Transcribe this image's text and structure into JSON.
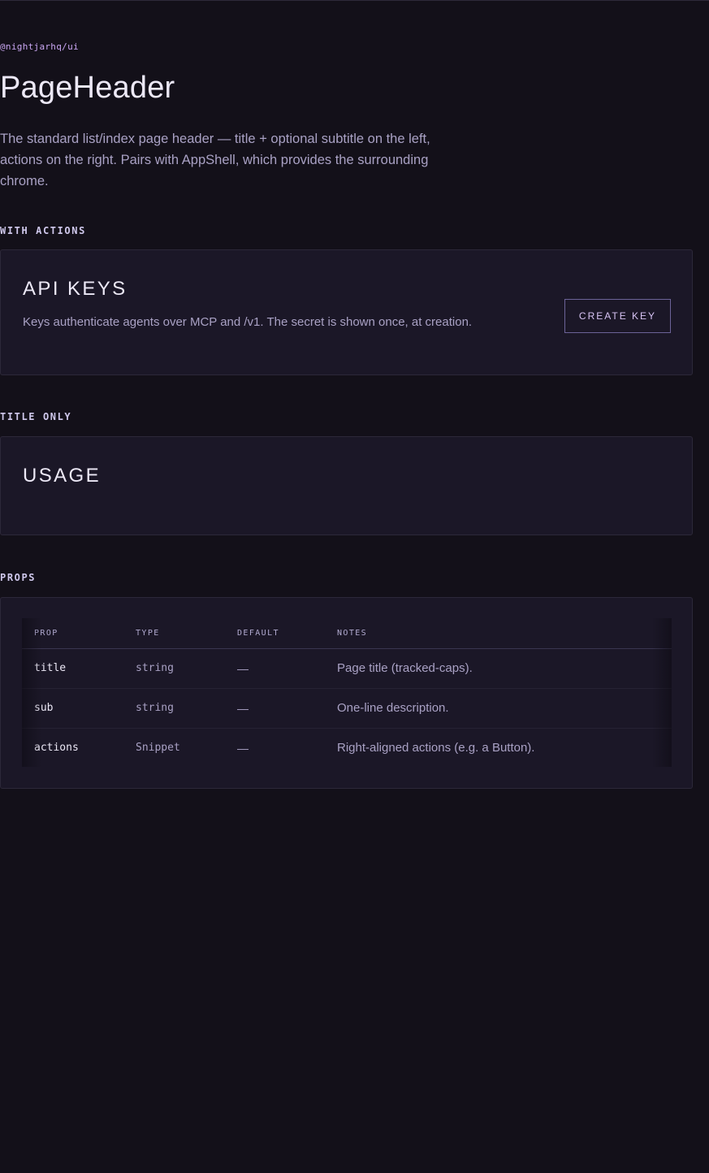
{
  "header": {
    "package": "@nightjarhq/ui",
    "title": "PageHeader",
    "description": "The standard list/index page header — title + optional subtitle on the left, actions on the right. Pairs with AppShell, which provides the surrounding chrome."
  },
  "sections": {
    "with_actions": {
      "label": "WITH ACTIONS",
      "card_title": "API KEYS",
      "card_sub": "Keys authenticate agents over MCP and /v1. The secret is shown once, at creation.",
      "button_label": "CREATE KEY"
    },
    "title_only": {
      "label": "TITLE ONLY",
      "card_title": "USAGE"
    },
    "props": {
      "label": "PROPS",
      "columns": [
        "PROP",
        "TYPE",
        "DEFAULT",
        "NOTES"
      ],
      "rows": [
        {
          "prop": "title",
          "type": "string",
          "default": "—",
          "notes": "Page title (tracked-caps)."
        },
        {
          "prop": "sub",
          "type": "string",
          "default": "—",
          "notes": "One-line description."
        },
        {
          "prop": "actions",
          "type": "Snippet",
          "default": "—",
          "notes": "Right-aligned actions (e.g. a Button)."
        }
      ]
    }
  },
  "colors": {
    "background": "#131019",
    "card": "#1b1727",
    "accent": "#c9a6f2"
  }
}
